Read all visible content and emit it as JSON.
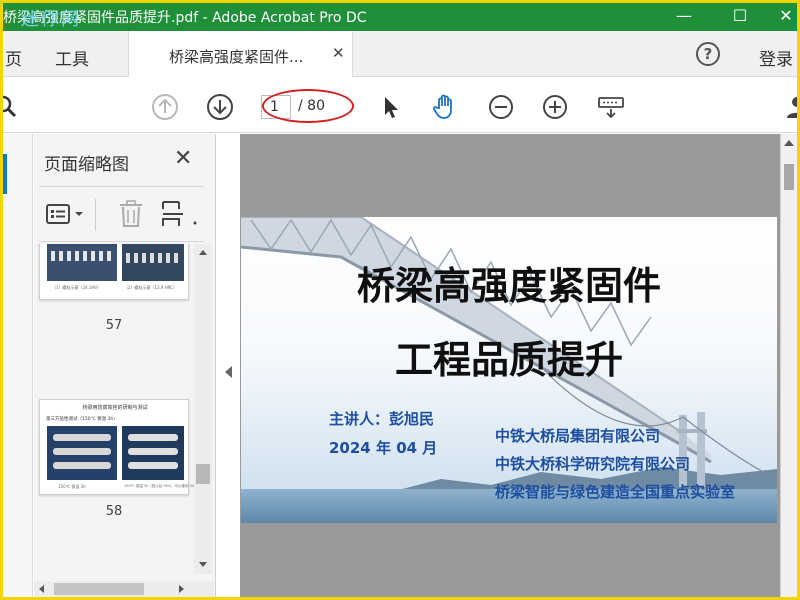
{
  "window": {
    "title": "桥梁高强度紧固件品质提升.pdf - Adobe Acrobat Pro DC",
    "watermark": "迷你网",
    "minimize": "—",
    "maximize": "☐",
    "close": "✕"
  },
  "tabs": {
    "home": "页",
    "tools": "工具",
    "document": "桥梁高强度紧固件...",
    "help": "?",
    "signin": "登录"
  },
  "toolbar": {
    "current_page": "1",
    "total_pages": "/ 80"
  },
  "thumbnails_panel": {
    "title": "页面缩略图",
    "close": "✕",
    "pages": [
      {
        "number": "57",
        "caption_left": "（1）螺栓示意（24.1HV）",
        "caption_right": "（2）螺栓示意（12.9 HRC）"
      },
      {
        "number": "58",
        "header": "桥梁用防腐高栓的研制与测试",
        "subtitle": "第三方盐性测试（150℃ 保温 3h）",
        "caption_left": "150℃ 保温 3h",
        "caption_right": "150℃ 保温 3h（回火后 90%，可以使用 3h）"
      }
    ]
  },
  "slide": {
    "title_line1": "桥梁高强度紧固件",
    "title_line2": "工程品质提升",
    "speaker": "主讲人：彭旭民",
    "date": "2024 年 04 月",
    "organizations": [
      "中铁大桥局集团有限公司",
      "中铁大桥科学研究院有限公司",
      "桥梁智能与绿色建造全国重点实验室"
    ]
  },
  "colors": {
    "title_bar": "#1f8f3a",
    "accent_blue": "#1a73c9",
    "annotation_red": "#d62020",
    "slide_text_blue": "#1e4fa0"
  },
  "icons": [
    "search-icon",
    "prev-page-icon",
    "next-page-icon",
    "select-arrow-icon",
    "hand-tool-icon",
    "zoom-out-icon",
    "zoom-in-icon",
    "keyboard-icon",
    "user-icon",
    "thumbnail-options-icon",
    "delete-icon",
    "page-insert-icon"
  ]
}
